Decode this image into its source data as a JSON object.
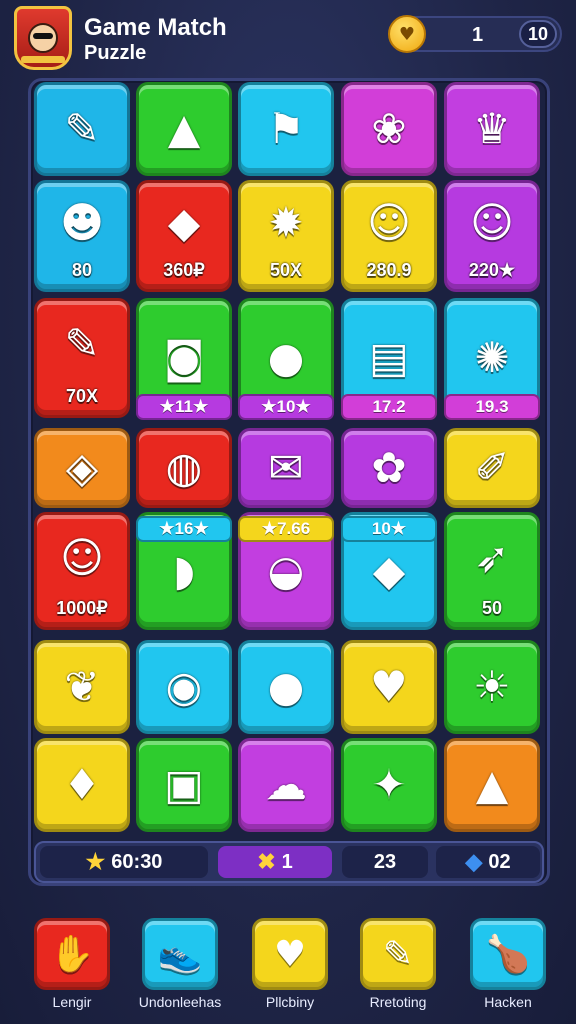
{
  "header": {
    "title_line1": "Game Match",
    "title_line2": "Puzzle",
    "score": "1",
    "score_max": "10"
  },
  "tiles": [
    {
      "color": "#1fb6e8",
      "icon": "pencil-icon",
      "glyph": "✎"
    },
    {
      "color": "#2ecc2e",
      "icon": "cone-icon",
      "glyph": "▲"
    },
    {
      "color": "#21c6ef",
      "icon": "flag-icon",
      "glyph": "⚑"
    },
    {
      "color": "#d23ed8",
      "icon": "ornament-icon",
      "glyph": "❀"
    },
    {
      "color": "#c23ee0",
      "icon": "crowned-face-icon",
      "glyph": "♛"
    },
    {
      "color": "#1fb6e8",
      "icon": "monster-icon",
      "glyph": "☻",
      "label": "80"
    },
    {
      "color": "#e8281f",
      "icon": "winged-gem-icon",
      "glyph": "◆",
      "label": "360₽"
    },
    {
      "color": "#f4d61c",
      "icon": "capsule-icon",
      "glyph": "✹",
      "label": "50X"
    },
    {
      "color": "#f4d61c",
      "icon": "cat-face-icon",
      "glyph": "☺",
      "label": "280.9"
    },
    {
      "color": "#b63ae0",
      "icon": "fox-face-icon",
      "glyph": "☺",
      "label": "220★"
    },
    {
      "color": "#e8281f",
      "icon": "pencil-icon",
      "glyph": "✎",
      "label": "70X"
    },
    {
      "color": "#2ecc2e",
      "icon": "camera-icon",
      "glyph": "◙"
    },
    {
      "color": "#2ecc2e",
      "icon": "blob-icon",
      "glyph": "●"
    },
    {
      "color": "#21c6ef",
      "icon": "scroll-icon",
      "glyph": "▤"
    },
    {
      "color": "#21c6ef",
      "icon": "gear-icon",
      "glyph": "✺"
    },
    {
      "color": "#f28a1c",
      "icon": "crystal-icon",
      "glyph": "◈"
    },
    {
      "color": "#e8281f",
      "icon": "speech-bubble-icon",
      "glyph": "◍"
    },
    {
      "color": "#b63ae0",
      "icon": "envelope-icon",
      "glyph": "✉"
    },
    {
      "color": "#b63ae0",
      "icon": "splat-icon",
      "glyph": "✿"
    },
    {
      "color": "#f4d61c",
      "icon": "brush-icon",
      "glyph": "✐"
    },
    {
      "color": "#e8281f",
      "icon": "smiley-icon",
      "glyph": "☺",
      "label": "1000₽"
    },
    {
      "color": "#2ecc2e",
      "icon": "pipe-icon",
      "glyph": "◗"
    },
    {
      "color": "#c23ee0",
      "icon": "mask-icon",
      "glyph": "◒"
    },
    {
      "color": "#21c6ef",
      "icon": "cheese-icon",
      "glyph": "◆"
    },
    {
      "color": "#2ecc2e",
      "icon": "bow-icon",
      "glyph": "➶",
      "label": "50"
    },
    {
      "color": "#f4d61c",
      "icon": "bean-icon",
      "glyph": "❦"
    },
    {
      "color": "#21c6ef",
      "icon": "target-icon",
      "glyph": "◉"
    },
    {
      "color": "#21c6ef",
      "icon": "ball-icon",
      "glyph": "●"
    },
    {
      "color": "#f4d61c",
      "icon": "heart-icon",
      "glyph": "♥"
    },
    {
      "color": "#2ecc2e",
      "icon": "sun-face-icon",
      "glyph": "☀"
    },
    {
      "color": "#f4d61c",
      "icon": "ice-cream-icon",
      "glyph": "♦"
    },
    {
      "color": "#2ecc2e",
      "icon": "frame-icon",
      "glyph": "▣"
    },
    {
      "color": "#c23ee0",
      "icon": "cloud-icon",
      "glyph": "☁"
    },
    {
      "color": "#2ecc2e",
      "icon": "ticket-icon",
      "glyph": "✦"
    },
    {
      "color": "#f28a1c",
      "icon": "traffic-cone-icon",
      "glyph": "▲"
    }
  ],
  "badges": [
    {
      "text": "★11★",
      "color": "#b63ae0"
    },
    {
      "text": "★10★",
      "color": "#b63ae0"
    },
    {
      "text": "17.2",
      "color": "#d23ed8"
    },
    {
      "text": "19.3",
      "color": "#d23ed8"
    },
    {
      "text": "★16★",
      "color": "#21c6ef"
    },
    {
      "text": "★7.66",
      "color": "#f4d61c"
    },
    {
      "text": "10★",
      "color": "#21c6ef"
    }
  ],
  "status": {
    "timer": "60:30",
    "timer_icon": "star-icon",
    "moves": "1",
    "moves_icon": "cross-icon",
    "level": "23",
    "gems": "02",
    "gems_icon": "gem-icon"
  },
  "nav": [
    {
      "label": "Lengir",
      "color": "#e8281f",
      "icon": "hand-icon",
      "glyph": "✋"
    },
    {
      "label": "Undonleehas",
      "color": "#21c6ef",
      "icon": "shoe-icon",
      "glyph": "👟"
    },
    {
      "label": "Pllcbiny",
      "color": "#f4d61c",
      "icon": "heart-icon",
      "glyph": "♥"
    },
    {
      "label": "Rretoting",
      "color": "#f4d61c",
      "icon": "pencil-icon",
      "glyph": "✎"
    },
    {
      "label": "Hacken",
      "color": "#21c6ef",
      "icon": "drumstick-icon",
      "glyph": "🍗"
    }
  ]
}
